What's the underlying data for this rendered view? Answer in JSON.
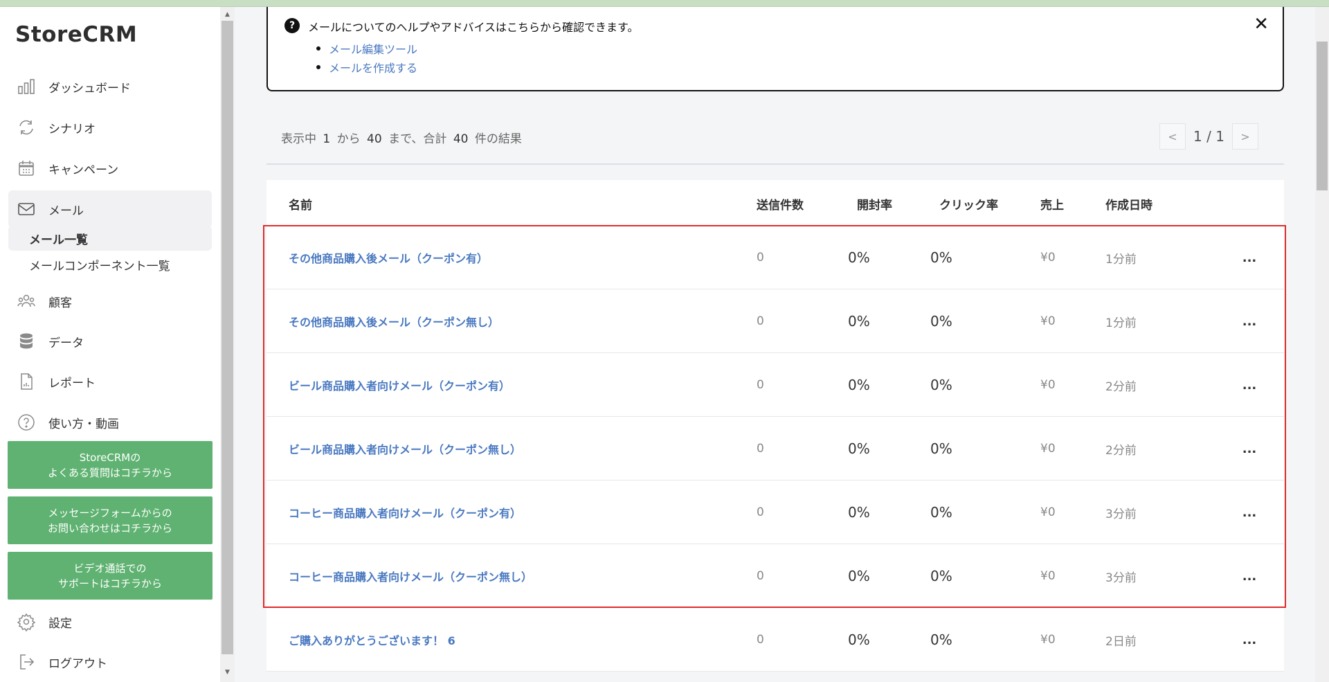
{
  "app": {
    "logo": "StoreCRM"
  },
  "sidebar": {
    "items": [
      {
        "label": "ダッシュボード",
        "icon": "bar-chart-icon"
      },
      {
        "label": "シナリオ",
        "icon": "sync-icon"
      },
      {
        "label": "キャンペーン",
        "icon": "calendar-icon"
      },
      {
        "label": "メール",
        "icon": "mail-icon"
      },
      {
        "label": "顧客",
        "icon": "users-icon"
      },
      {
        "label": "データ",
        "icon": "database-icon"
      },
      {
        "label": "レポート",
        "icon": "report-icon"
      },
      {
        "label": "使い方・動画",
        "icon": "help-circle-icon"
      }
    ],
    "subitems": [
      {
        "label": "メール一覧"
      },
      {
        "label": "メールコンポーネント一覧"
      }
    ],
    "green_buttons": [
      {
        "line1": "StoreCRMの",
        "line2": "よくある質問はコチラから"
      },
      {
        "line1": "メッセージフォームからの",
        "line2": "お問い合わせはコチラから"
      },
      {
        "line1": "ビデオ通話での",
        "line2": "サポートはコチラから"
      }
    ],
    "settings": {
      "label": "設定",
      "icon": "gear-icon"
    },
    "logout": {
      "label": "ログアウト",
      "icon": "logout-icon"
    }
  },
  "help": {
    "text": "メールについてのヘルプやアドバイスはこちらから確認できます。",
    "links": [
      "メール編集ツール",
      "メールを作成する"
    ],
    "close": "✕"
  },
  "summary": {
    "prefix": "表示中",
    "from": "1",
    "from_suffix": "から",
    "to": "40",
    "to_suffix": "まで、合計",
    "total": "40",
    "total_suffix": "件の結果"
  },
  "pager": {
    "prev": "<",
    "label": "1 / 1",
    "next": ">"
  },
  "table": {
    "headers": {
      "name": "名前",
      "sent": "送信件数",
      "open": "開封率",
      "click": "クリック率",
      "sales": "売上",
      "date": "作成日時"
    },
    "rows": [
      {
        "name": "その他商品購入後メール（クーポン有）",
        "sent": "0",
        "open": "0%",
        "click": "0%",
        "sales": "¥0",
        "date": "1分前",
        "more": "..."
      },
      {
        "name": "その他商品購入後メール（クーポン無し）",
        "sent": "0",
        "open": "0%",
        "click": "0%",
        "sales": "¥0",
        "date": "1分前",
        "more": "..."
      },
      {
        "name": "ビール商品購入者向けメール（クーポン有）",
        "sent": "0",
        "open": "0%",
        "click": "0%",
        "sales": "¥0",
        "date": "2分前",
        "more": "..."
      },
      {
        "name": "ビール商品購入者向けメール（クーポン無し）",
        "sent": "0",
        "open": "0%",
        "click": "0%",
        "sales": "¥0",
        "date": "2分前",
        "more": "..."
      },
      {
        "name": "コーヒー商品購入者向けメール（クーポン有）",
        "sent": "0",
        "open": "0%",
        "click": "0%",
        "sales": "¥0",
        "date": "3分前",
        "more": "..."
      },
      {
        "name": "コーヒー商品購入者向けメール（クーポン無し）",
        "sent": "0",
        "open": "0%",
        "click": "0%",
        "sales": "¥0",
        "date": "3分前",
        "more": "..."
      },
      {
        "name": "ご購入ありがとうございます！ 6",
        "sent": "0",
        "open": "0%",
        "click": "0%",
        "sales": "¥0",
        "date": "2日前",
        "more": "..."
      }
    ]
  },
  "colors": {
    "accent_green": "#5fb271",
    "link_blue": "#4a79c1",
    "highlight_red": "#e02b2b"
  }
}
